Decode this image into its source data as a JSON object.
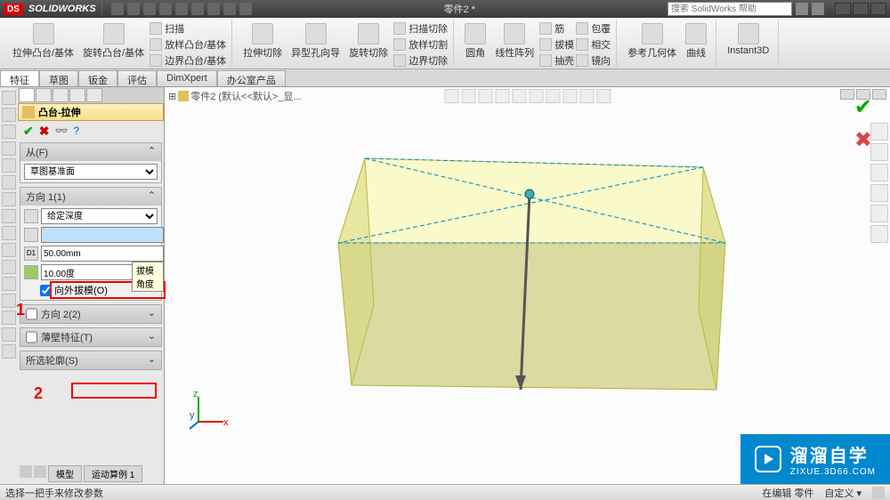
{
  "title_bar": {
    "logo_text": "SOLIDWORKS",
    "doc_name": "零件2 *",
    "search_placeholder": "搜索 SolidWorks 帮助"
  },
  "ribbon": {
    "groups": [
      {
        "big": [
          {
            "label": "拉伸凸台/基体"
          },
          {
            "label": "旋转凸台/基体"
          }
        ],
        "small": [
          "扫描",
          "放样凸台/基体",
          "边界凸台/基体"
        ]
      },
      {
        "big": [
          {
            "label": "拉伸切除"
          },
          {
            "label": "异型孔向导"
          },
          {
            "label": "旋转切除"
          }
        ],
        "small": [
          "扫描切除",
          "放样切割",
          "边界切除"
        ]
      },
      {
        "big": [
          {
            "label": "圆角"
          },
          {
            "label": "线性阵列"
          }
        ],
        "small": [
          "筋",
          "拔模",
          "抽壳"
        ],
        "small2": [
          "包覆",
          "相交",
          "镜向"
        ]
      },
      {
        "big": [
          {
            "label": "参考几何体"
          },
          {
            "label": "曲线"
          }
        ]
      },
      {
        "big": [
          {
            "label": "Instant3D"
          }
        ]
      }
    ]
  },
  "tabs": [
    "特征",
    "草图",
    "钣金",
    "评估",
    "DimXpert",
    "办公室产品"
  ],
  "active_tab": "特征",
  "pm": {
    "title": "凸台-拉伸",
    "sections": {
      "from": {
        "header": "从(F)",
        "option": "草图基准面"
      },
      "dir1": {
        "header": "方向 1(1)",
        "end_condition": "给定深度",
        "depth": "50.00mm",
        "draft_angle": "10.00度",
        "draft_tooltip": "拔模角度",
        "draft_out_label": "向外拔模(O)",
        "draft_out_checked": true,
        "slider_value": ""
      },
      "dir2": {
        "header": "方向 2(2)"
      },
      "thin": {
        "header": "薄壁特征(T)"
      },
      "contour": {
        "header": "所选轮廓(S)"
      }
    }
  },
  "breadcrumb": "零件2 (默认<<默认>_显...",
  "bottom_tabs": [
    "模型",
    "运动算例 1"
  ],
  "status": {
    "left": "选择一把手来修改参数",
    "mode": "在编辑 零件",
    "custom": "自定义 ▾"
  },
  "annotations": {
    "n1": "1",
    "n2": "2"
  },
  "watermark": {
    "title": "溜溜自学",
    "url": "ZIXUE.3D66.COM"
  },
  "colors": {
    "brand": "#d00",
    "accent": "#0088cc",
    "extrude_face": "#e8e88a",
    "extrude_top": "#f5f5a0"
  }
}
